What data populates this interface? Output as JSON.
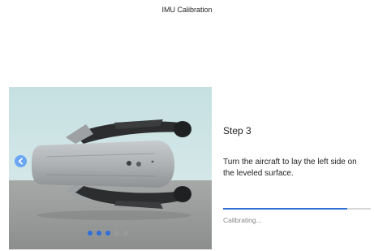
{
  "header": {
    "title": "IMU Calibration"
  },
  "carousel": {
    "image_icon": "drone-folded-side-view",
    "prev_icon": "chevron-left-icon",
    "dot_count": 5,
    "active_dots": 3
  },
  "step": {
    "title": "Step 3",
    "instruction": "Turn the aircraft to lay the left side on the leveled surface."
  },
  "progress": {
    "fraction": 0.84,
    "status": "Calibrating...",
    "color": "#2f6fd8"
  }
}
